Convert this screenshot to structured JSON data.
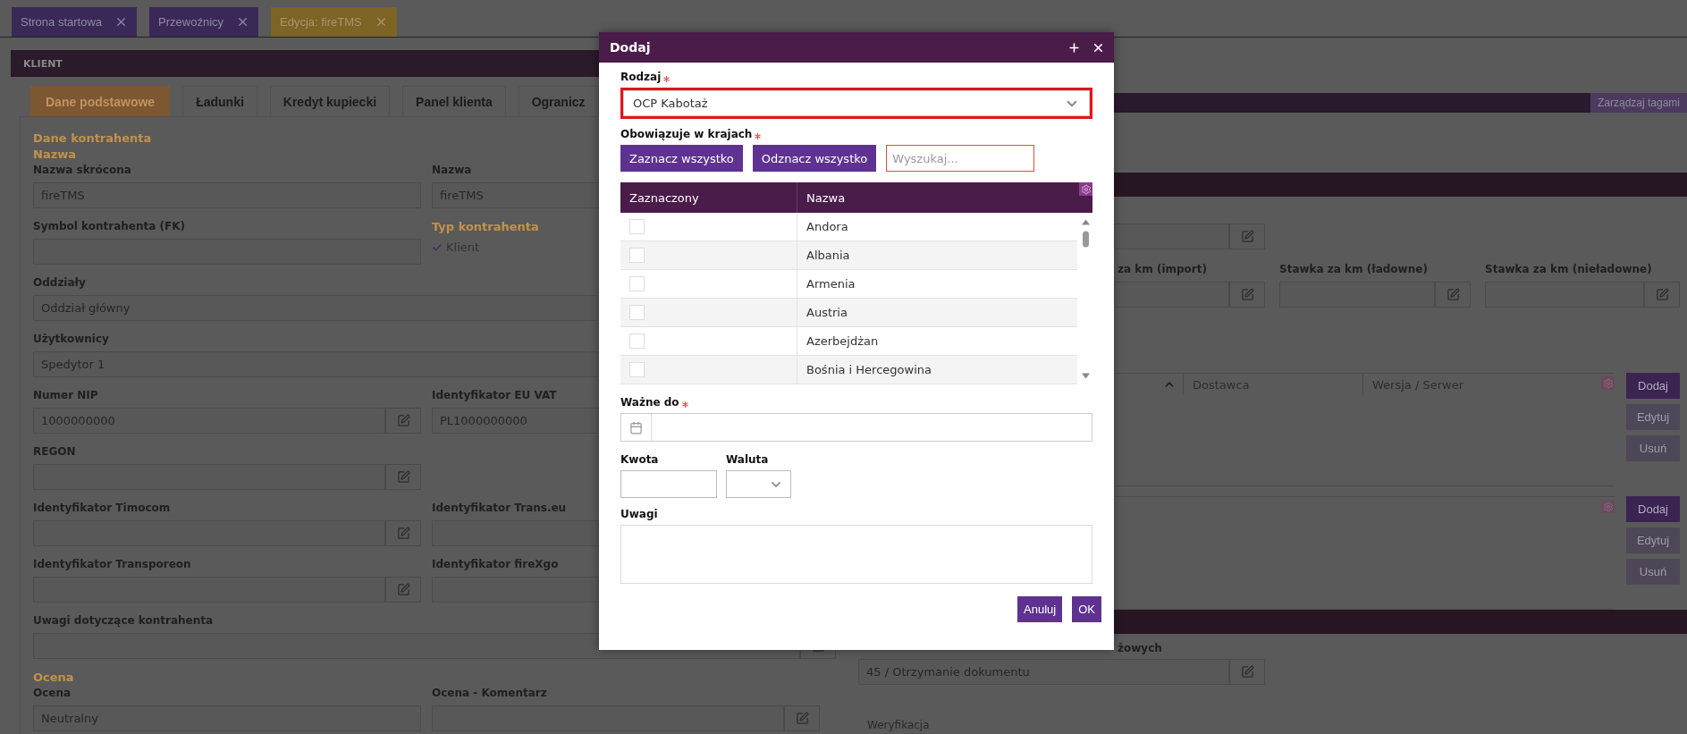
{
  "open_tabs": [
    {
      "label": "Strona startowa",
      "selected": false
    },
    {
      "label": "Przewoźnicy",
      "selected": false
    },
    {
      "label": "Edycja: fireTMS",
      "selected": true
    }
  ],
  "client_panel": {
    "title": "KLIENT",
    "tabs": [
      {
        "label": "Dane podstawowe",
        "selected": true
      },
      {
        "label": "Ładunki",
        "selected": false
      },
      {
        "label": "Kredyt kupiecki",
        "selected": false
      },
      {
        "label": "Panel klienta",
        "selected": false
      },
      {
        "label": "Ogranicz",
        "selected": false
      }
    ],
    "form": [
      {
        "kind": "heading",
        "text": "Dane kontrahenta"
      },
      {
        "kind": "heading",
        "text": "Nazwa"
      },
      {
        "kind": "row",
        "cells": [
          {
            "kind": "field",
            "label": "Nazwa skrócona",
            "value": "fireTMS",
            "edit_button": false
          },
          {
            "kind": "field",
            "label": "Nazwa",
            "value": "fireTMS",
            "edit_button": false
          }
        ]
      },
      {
        "kind": "row",
        "cells": [
          {
            "kind": "field",
            "label": "Symbol kontrahenta (FK)",
            "edit_button": false
          },
          {
            "kind": "checklist",
            "label": "Typ kontrahenta",
            "items": [
              {
                "label": "Klient",
                "checked": true
              }
            ]
          }
        ]
      },
      {
        "kind": "wide",
        "cells": [
          {
            "kind": "field",
            "label": "Oddziały",
            "value": "Oddział główny",
            "edit_button": false
          }
        ]
      },
      {
        "kind": "wide",
        "cells": [
          {
            "kind": "field",
            "label": "Użytkownicy",
            "value": "Spedytor 1",
            "edit_button": false
          }
        ]
      },
      {
        "kind": "row",
        "cells": [
          {
            "kind": "field",
            "label": "Numer NIP",
            "value": "1000000000",
            "edit_button": true
          },
          {
            "kind": "field",
            "label": "Identyfikator EU VAT",
            "value": "PL1000000000",
            "edit_button": false
          }
        ]
      },
      {
        "kind": "row",
        "cells": [
          {
            "kind": "field",
            "label": "REGON",
            "edit_button": true
          }
        ]
      },
      {
        "kind": "row",
        "cells": [
          {
            "kind": "field",
            "label": "Identyfikator Timocom",
            "edit_button": true
          },
          {
            "kind": "field",
            "label": "Identyfikator Trans.eu",
            "edit_button": false
          }
        ]
      },
      {
        "kind": "row",
        "cells": [
          {
            "kind": "field",
            "label": "Identyfikator Transporeon",
            "edit_button": true
          },
          {
            "kind": "field",
            "label": "Identyfikator fireXgo",
            "edit_button": false
          }
        ]
      },
      {
        "kind": "wide",
        "cells": [
          {
            "kind": "field",
            "label": "Uwagi dotyczące kontrahenta",
            "edit_button": true
          }
        ]
      },
      {
        "kind": "heading",
        "text": "Ocena"
      },
      {
        "kind": "row",
        "cells": [
          {
            "kind": "field",
            "label": "Ocena",
            "value": "Neutralny",
            "edit_button": false
          },
          {
            "kind": "field",
            "label": "Ocena - Komentarz",
            "edit_button": true
          }
        ]
      }
    ]
  },
  "right_panel": {
    "tags_button": "Zarządzaj tagami",
    "rates": [
      {
        "label": "za km (import)"
      },
      {
        "label": "Stawka za km (ładowne)"
      },
      {
        "label": "Stawka za km (nieładowne)"
      }
    ],
    "tables": [
      {
        "columns": [
          "Dostawca",
          "Wersja / Serwer"
        ],
        "buttons": [
          {
            "label": "Dodaj",
            "disabled": false
          },
          {
            "label": "Edytuj",
            "disabled": true
          },
          {
            "label": "Usuń",
            "disabled": true
          }
        ]
      },
      {
        "buttons": [
          {
            "label": "Dodaj",
            "disabled": false
          },
          {
            "label": "Edytuj",
            "disabled": true
          },
          {
            "label": "Usuń",
            "disabled": true
          }
        ]
      }
    ],
    "document_field": {
      "label": "żowych",
      "value": "45 / Otrzymanie dokumentu"
    },
    "verification_label": "Weryfikacja"
  },
  "dialog": {
    "title": "Dodaj",
    "type_field": {
      "label": "Rodzaj",
      "required": true,
      "value": "OCP Kabotaż",
      "invalid": true
    },
    "countries": {
      "label": "Obowiązuje w krajach",
      "required": true,
      "select_all": "Zaznacz wszystko",
      "deselect_all": "Odznacz wszystko",
      "search": {
        "placeholder": "Wyszukaj...",
        "invalid": true
      },
      "columns": [
        "Zaznaczony",
        "Nazwa"
      ],
      "rows": [
        {
          "name": "Andora",
          "checked": false
        },
        {
          "name": "Albania",
          "checked": false
        },
        {
          "name": "Armenia",
          "checked": false
        },
        {
          "name": "Austria",
          "checked": false
        },
        {
          "name": "Azerbejdżan",
          "checked": false
        },
        {
          "name": "Bośnia i Hercegowina",
          "checked": false
        }
      ]
    },
    "valid_until": {
      "label": "Ważne do",
      "required": true
    },
    "amount": {
      "label": "Kwota"
    },
    "currency": {
      "label": "Waluta"
    },
    "notes": {
      "label": "Uwagi"
    },
    "buttons": [
      {
        "label": "Anuluj"
      },
      {
        "label": "OK"
      }
    ]
  }
}
